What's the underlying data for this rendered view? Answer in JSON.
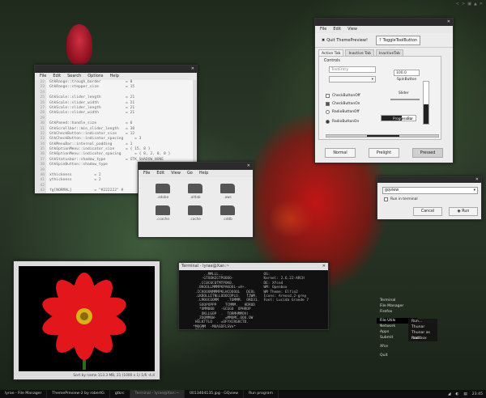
{
  "top_bar": {
    "icons": [
      "<",
      ">",
      "▣",
      "▲",
      "✕"
    ]
  },
  "editor": {
    "menus": [
      "File",
      "Edit",
      "Search",
      "Options",
      "Help"
    ],
    "line_numbers": [
      "22",
      "23",
      "24",
      "25",
      "26",
      "27",
      "28",
      "29",
      "30",
      "31",
      "32",
      "33",
      "34",
      "35",
      "36",
      "37",
      "38",
      "39",
      "40",
      "41",
      "42",
      "43",
      "44"
    ],
    "lines": [
      "GtkRange::trough_border           = 0",
      "GtkRange::stepper_size            = 15",
      "",
      "GtkScale::slider_length           = 21",
      "GtkScale::slider_width            = 21",
      "GtkScale::slider_length           = 21",
      "GtkScale::slider_width            = 21",
      "",
      "GtkPaned::handle_size             = 6",
      "GtkScrollbar::min_slider_length   = 30",
      "GtkCheckButton::indicator_size    = 12",
      "GtkCheckButton::indicator_spacing     = 3",
      "GtkMenuBar::internal_padding      = 1",
      "GtkOptionMenu::indicator_size     = { 15, 8 }",
      "GtkOptionMenu::indicator_spacing      = { 8, 2, 0, 0 }",
      "GtkStatusbar::shadow_type         = GTK_SHADOW_NONE",
      "GtkSpinButton::shadow_type  ",
      "",
      "xthickness          = 2",
      "ythickness          = 2",
      "",
      "fg[NORMAL]          = \"#222222\" #",
      "fg[PRELIGHT]        = \"#222222\" #"
    ]
  },
  "theme_preview": {
    "menus": [
      "File",
      "Edit",
      "View"
    ],
    "toolbar": {
      "quit": "Quit ThemePreview!",
      "toggle": "ToggleToolButton"
    },
    "tabs": [
      "Active Tab",
      "Inactive Tab",
      "InactiveTab"
    ],
    "controls_label": "Controls",
    "text_entry": "TextEntry",
    "spin_value": "100.0",
    "spin_label": "SpinButton",
    "slider_label": "Slider",
    "progress_label": "ProgressBar",
    "progress_fraction": 0.6,
    "checks": [
      {
        "label": "CheckButtonOff",
        "on": false
      },
      {
        "label": "CheckButtonOn",
        "on": true
      }
    ],
    "radios": [
      {
        "label": "RadioButtonOff",
        "on": false
      },
      {
        "label": "RadioButtonOn",
        "on": true
      }
    ],
    "buttons": {
      "normal": "Normal",
      "prelight": "Prelight",
      "pressed": "Pressed"
    }
  },
  "file_manager": {
    "menus": [
      "File",
      "Edit",
      "View",
      "Go",
      "Help"
    ],
    "items": [
      ".adobe",
      ".alltab",
      ".aws",
      ".ccache",
      ".cache",
      ".cddb"
    ]
  },
  "run_dialog": {
    "command": "gqview",
    "checkbox_label": "Run in terminal",
    "cancel": "Cancel",
    "run": "Run"
  },
  "image_viewer": {
    "status": "Sort by name  113.3 MB,  21 (1000 x 1)    1/6    -4.4"
  },
  "terminal": {
    "title": "Terminal - lyrae@Xan:~",
    "lines": [
      "          ..MMLLL..                   OS:",
      "         -GTOOKEGTPOOOO-              Kernel: 2.6.22-ARCH",
      "        .CC0C0C0TMTPOK0.              DE: Xfce4",
      "       .BKOOLLMMMPKPAKOOL-=H+.        WM: Openbox",
      "      .ICKOOONMMMPKLHCOOOOL   DEOL    WM Theme: Elfin2",
      "      .LKBOLLETNLLOOOCOPLO.   TZWM.   Icons: Areosd.2-grey",
      "       .LMOOCOOMM    .TOMMM.  ORD31.  Font: Lucida Grande 7",
      "        SOOPOPPP    TCMMM.   HDROD",
      "        *OMM000   -GCGGO  OPHROP",
      "         OKLLGOP  .  TORMHMMOV)",
      "       _ZOOMMOW-    =MMOMC.OOO.OW",
      "      HELKTTLO  . =OFYXCRGKCTD.",
      "     *MOGMM  -MOASDFLSVe*",
      "     .TOOO",
      "",
      "[lyrae@Xan ~]$ scrot -cd 5 xfce.png",
      "Taking shot in 5.. 4.. 3.. 2.. 1.."
    ]
  },
  "desktop_menu": {
    "items": [
      "Terminal",
      "File Manager",
      "Firefox",
      "",
      "File Utils",
      "Network",
      "Apps",
      "Submit",
      "",
      "Xfce",
      "",
      "Quit"
    ],
    "submenu": [
      "Run...",
      "Thunar",
      "Thunar as root",
      "Rootbox"
    ]
  },
  "taskbar": {
    "tasks": [
      "lyrae - File Manager",
      "ThemePreview-2 by robertG",
      "gtkrc",
      "Terminal - lyrae@Xan:~",
      "0013464135.jpg - GQview",
      "Run program"
    ],
    "active_index": 3,
    "tray": [
      "◢",
      "◐",
      "▤",
      "23:45"
    ]
  }
}
